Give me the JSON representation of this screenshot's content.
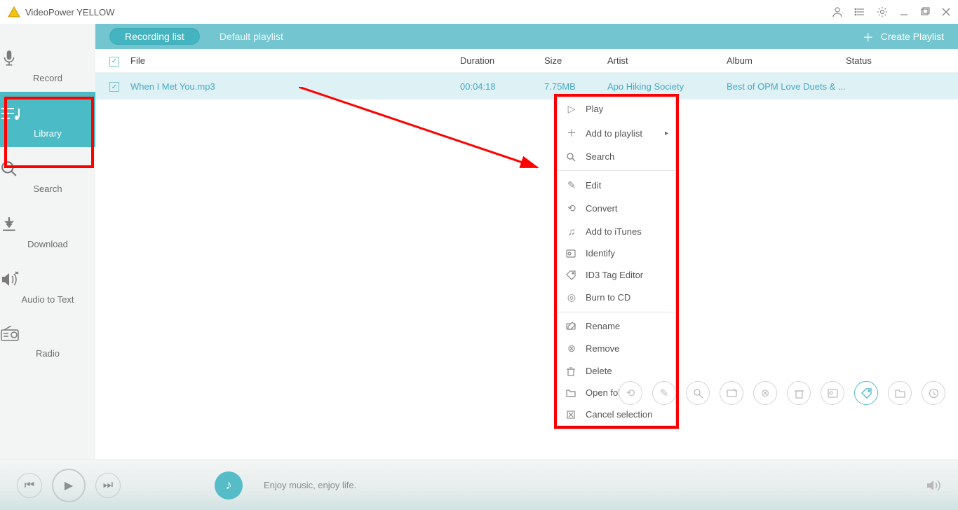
{
  "app": {
    "title": "VideoPower YELLOW"
  },
  "sidebar": {
    "items": [
      {
        "label": "Record"
      },
      {
        "label": "Library"
      },
      {
        "label": "Search"
      },
      {
        "label": "Download"
      },
      {
        "label": "Audio to Text"
      },
      {
        "label": "Radio"
      }
    ]
  },
  "tabbar": {
    "recording_list": "Recording list",
    "default_playlist": "Default playlist",
    "create_playlist": "Create Playlist"
  },
  "table": {
    "headers": {
      "file": "File",
      "duration": "Duration",
      "size": "Size",
      "artist": "Artist",
      "album": "Album",
      "status": "Status"
    },
    "rows": [
      {
        "file": "When I Met You.mp3",
        "duration": "00:04:18",
        "size": "7.75MB",
        "artist": "Apo Hiking Society",
        "album": "Best of OPM Love Duets & ...",
        "status": ""
      }
    ]
  },
  "context_menu": {
    "play": "Play",
    "add_to_playlist": "Add to playlist",
    "search": "Search",
    "edit": "Edit",
    "convert": "Convert",
    "add_to_itunes": "Add to iTunes",
    "identify": "Identify",
    "id3_tag_editor": "ID3 Tag Editor",
    "burn_to_cd": "Burn to CD",
    "rename": "Rename",
    "remove": "Remove",
    "delete": "Delete",
    "open_folder": "Open folder",
    "cancel_selection": "Cancel selection"
  },
  "player": {
    "text": "Enjoy music, enjoy life."
  }
}
